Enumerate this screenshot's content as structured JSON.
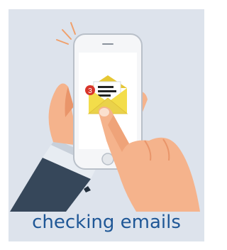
{
  "caption": "checking emails",
  "icons": {
    "illustration": "hand-holding-phone-checking-email",
    "notification": "notification-badge",
    "envelope": "open-envelope-icon"
  },
  "notification": {
    "count": "3"
  },
  "colors": {
    "background": "#dde3ec",
    "caption": "#1f5796",
    "skin": "#f5b38c",
    "skin_shadow": "#e9956a",
    "sleeve": "#36475a",
    "envelope": "#f3dd4a",
    "badge": "#d8352b"
  }
}
